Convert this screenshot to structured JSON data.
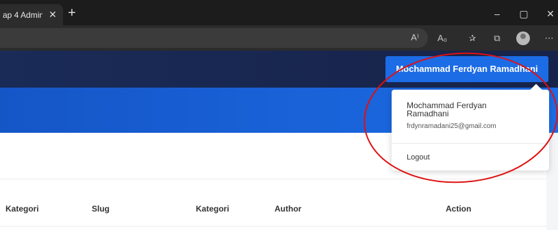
{
  "browser": {
    "tab_title": "ap 4 Admin",
    "tab_close_glyph": "✕",
    "new_tab_glyph": "+",
    "window_controls": {
      "minimize": "–",
      "maximize": "▢",
      "close": "✕"
    },
    "toolbar_icons": [
      "read-aloud-icon",
      "immersive-reader-icon",
      "favorites-icon",
      "collections-icon",
      "profile-avatar",
      "more-menu-icon"
    ],
    "toolbar_glyphs": {
      "read_aloud": "A⁾",
      "immersive": "A₀",
      "favorites": "✰",
      "collections": "⧉",
      "more": "⋯"
    }
  },
  "header": {
    "user_button_label": "Mochammad Ferdyan Ramadhani"
  },
  "dropdown": {
    "name": "Mochammad Ferdyan Ramadhani",
    "email": "frdynramadani25@gmail.com",
    "logout_label": "Logout"
  },
  "table": {
    "columns": [
      "Kategori",
      "Slug",
      "Kategori",
      "Author",
      "Action"
    ]
  },
  "colors": {
    "header_bg": "#1a2b57",
    "banner_bg": "#1c6ce6",
    "user_button": "#1c6ce6",
    "annotation": "#e01010"
  }
}
